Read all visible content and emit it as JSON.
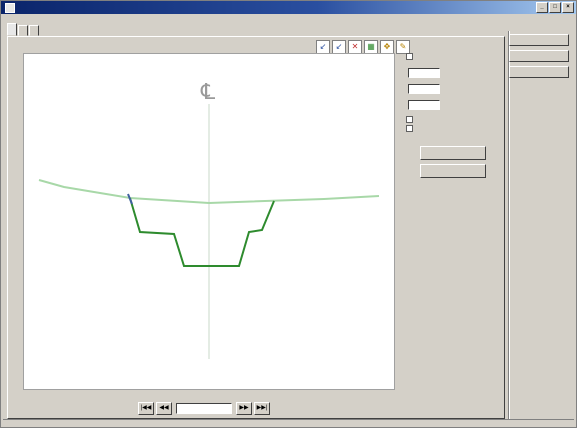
{
  "window": {
    "title": "",
    "controls": [
      "_",
      "□",
      "×"
    ]
  },
  "tabs": [
    {
      "label": "",
      "active": true
    },
    {
      "label": "",
      "active": false
    },
    {
      "label": "",
      "active": false
    }
  ],
  "toolbar": {
    "tools": [
      {
        "icon": "zoom-in-icon",
        "glyph": "↙"
      },
      {
        "icon": "zoom-out-icon",
        "glyph": "↙"
      },
      {
        "icon": "delete-icon",
        "glyph": "✕"
      },
      {
        "icon": "grid-icon",
        "glyph": "▦"
      },
      {
        "icon": "pan-icon",
        "glyph": "✥"
      },
      {
        "icon": "select-icon",
        "glyph": "✎"
      }
    ]
  },
  "plot": {
    "centerline_symbol": "℄",
    "colors": {
      "ground": "#a8d8a8",
      "channel": "#2e8b2e",
      "left_bank": "#4060a0",
      "centerline": "#c8d8c8"
    }
  },
  "side_panel": {
    "group1_label": "",
    "checkbox1_label": "",
    "group2_label": "",
    "field1_label": "",
    "field1_value": "",
    "field2_label": "",
    "field2_value": "",
    "field3_label": "",
    "field3_value": "",
    "check_a_label": "",
    "check_b_label": "",
    "button1_label": "",
    "button2_label": ""
  },
  "right_buttons": [
    {
      "label": ""
    },
    {
      "label": ""
    },
    {
      "label": ""
    }
  ],
  "nav": {
    "first": "|◀◀",
    "prev": "◀◀",
    "next": "▶▶",
    "last": "▶▶|",
    "station_value": ""
  }
}
